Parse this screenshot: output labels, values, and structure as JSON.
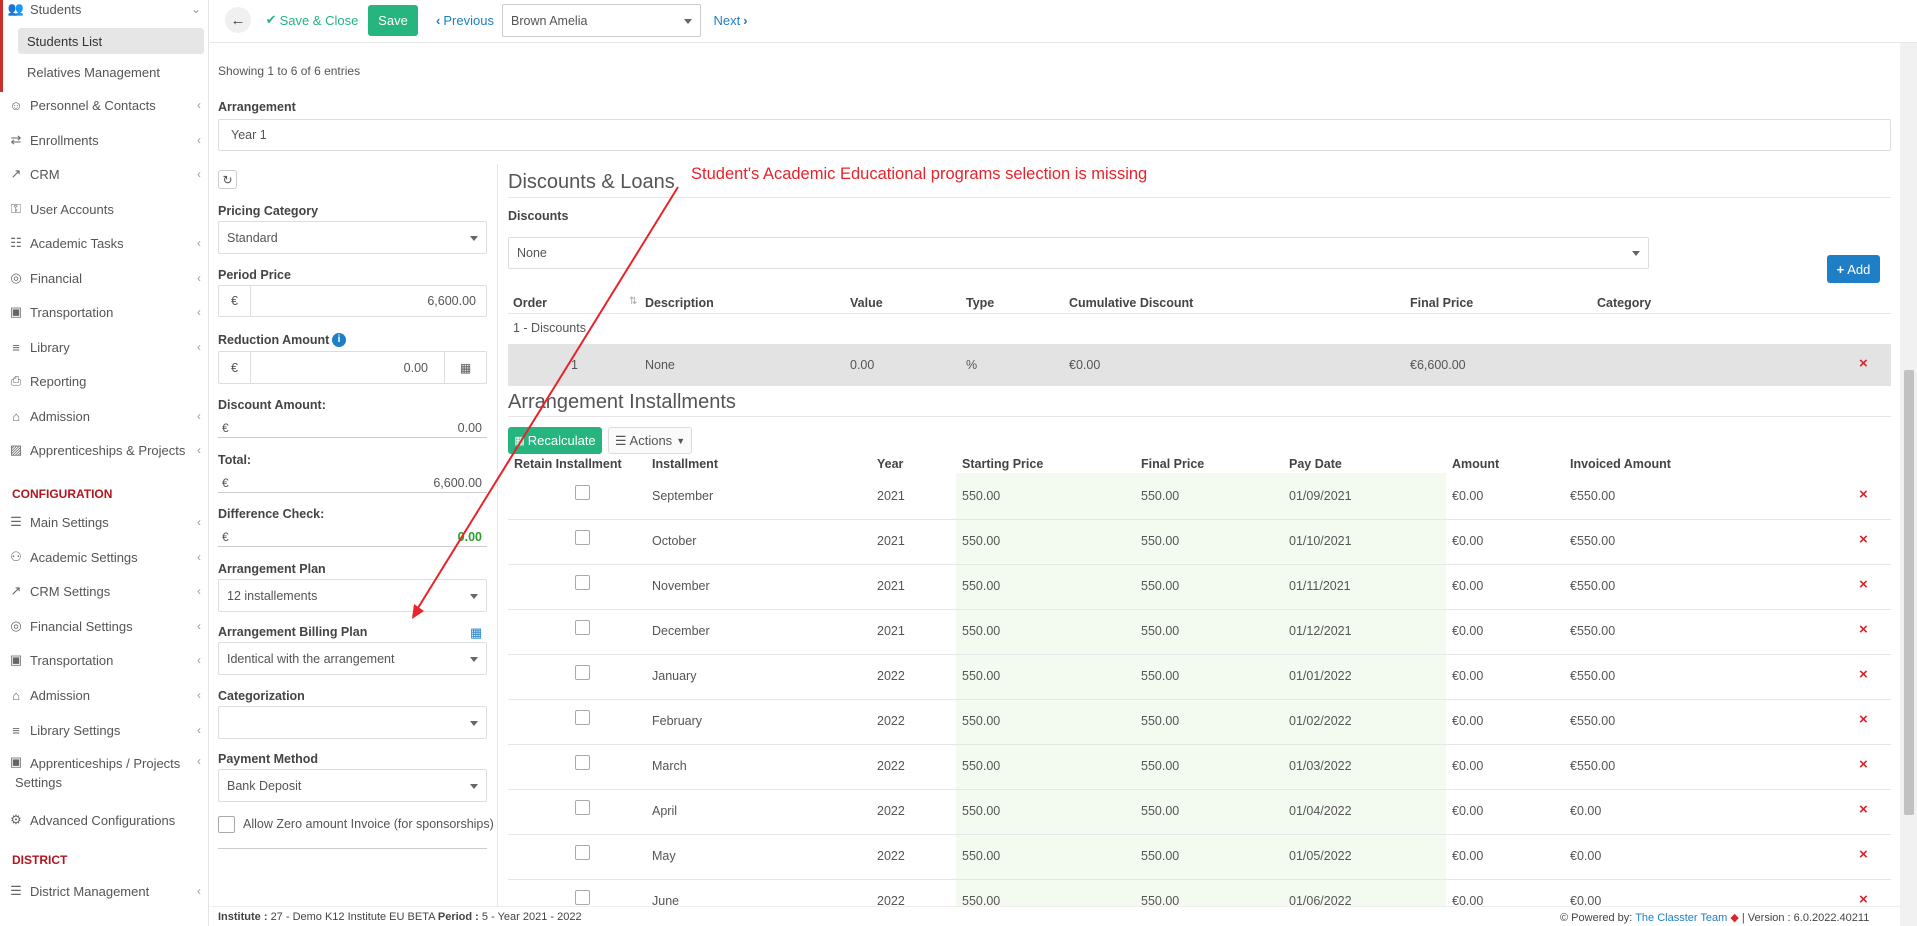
{
  "sidebar": {
    "students_label": "Students",
    "students_list": "Students List",
    "relatives": "Relatives Management",
    "items": [
      {
        "label": "Personnel & Contacts",
        "icon": "person-icon"
      },
      {
        "label": "Enrollments",
        "icon": "exchange-icon"
      },
      {
        "label": "CRM",
        "icon": "crm-icon"
      },
      {
        "label": "User Accounts",
        "icon": "key-icon"
      },
      {
        "label": "Academic Tasks",
        "icon": "tasks-icon"
      },
      {
        "label": "Financial",
        "icon": "coins-icon"
      },
      {
        "label": "Transportation",
        "icon": "bus-icon"
      },
      {
        "label": "Library",
        "icon": "books-icon"
      },
      {
        "label": "Reporting",
        "icon": "printer-icon"
      },
      {
        "label": "Admission",
        "icon": "institution-icon"
      },
      {
        "label": "Apprenticeships & Projects",
        "icon": "cube-icon"
      }
    ],
    "configuration_header": "CONFIGURATION",
    "config_items": [
      {
        "label": "Main Settings",
        "icon": "sliders-icon"
      },
      {
        "label": "Academic Settings",
        "icon": "users-icon"
      },
      {
        "label": "CRM Settings",
        "icon": "crm-icon"
      },
      {
        "label": "Financial Settings",
        "icon": "coins-icon"
      },
      {
        "label": "Transportation",
        "icon": "bus-icon"
      },
      {
        "label": "Admission",
        "icon": "institution-icon"
      },
      {
        "label": "Library Settings",
        "icon": "books-icon"
      }
    ],
    "apprenticeship_settings_1": "Apprenticeships / Projects",
    "apprenticeship_settings_2": "Settings",
    "advanced": "Advanced Configurations",
    "district_header": "DISTRICT",
    "district_mgmt": "District Management"
  },
  "topbar": {
    "save_close": "Save & Close",
    "save": "Save",
    "previous": "Previous",
    "student_select": "Brown Amelia",
    "next": "Next"
  },
  "main": {
    "showing": "Showing 1 to 6 of 6 entries",
    "arrangement_label": "Arrangement",
    "arrangement_value": "Year 1",
    "pricing_category_label": "Pricing Category",
    "pricing_category_value": "Standard",
    "period_price_label": "Period Price",
    "period_price_value": "6,600.00",
    "reduction_label": "Reduction Amount",
    "reduction_value": "0.00",
    "discount_amount_label": "Discount Amount:",
    "discount_amount_value": "0.00",
    "total_label": "Total:",
    "total_value": "6,600.00",
    "difference_label": "Difference Check:",
    "difference_value": "0.00",
    "currency": "€",
    "plan_label": "Arrangement Plan",
    "plan_value": "12 installements",
    "billing_label": "Arrangement Billing Plan",
    "billing_value": "Identical with the arrangement",
    "categorization_label": "Categorization",
    "categorization_value": "",
    "payment_label": "Payment Method",
    "payment_value": "Bank Deposit",
    "zero_invoice_label": "Allow Zero amount Invoice (for sponsorships)"
  },
  "annotation": "Student's Academic Educational programs selection is missing",
  "discounts": {
    "title": "Discounts & Loans",
    "label": "Discounts",
    "select_value": "None",
    "add_button": "Add",
    "headers": [
      "Order",
      "Description",
      "Value",
      "Type",
      "Cumulative Discount",
      "Final Price",
      "Category"
    ],
    "group": "1 - Discounts",
    "row": {
      "order": "1",
      "description": "None",
      "value": "0.00",
      "type": "%",
      "cumulative": "€0.00",
      "final": "€6,600.00",
      "category": ""
    }
  },
  "installments": {
    "title": "Arrangement Installments",
    "recalculate": "Recalculate",
    "actions": "Actions",
    "headers": [
      "Retain Installment",
      "Installment",
      "Year",
      "Starting Price",
      "Final Price",
      "Pay Date",
      "Amount",
      "Invoiced Amount"
    ],
    "rows": [
      {
        "month": "September",
        "year": "2021",
        "start": "550.00",
        "final": "550.00",
        "date": "01/09/2021",
        "amount": "€0.00",
        "invoiced": "€550.00"
      },
      {
        "month": "October",
        "year": "2021",
        "start": "550.00",
        "final": "550.00",
        "date": "01/10/2021",
        "amount": "€0.00",
        "invoiced": "€550.00"
      },
      {
        "month": "November",
        "year": "2021",
        "start": "550.00",
        "final": "550.00",
        "date": "01/11/2021",
        "amount": "€0.00",
        "invoiced": "€550.00"
      },
      {
        "month": "December",
        "year": "2021",
        "start": "550.00",
        "final": "550.00",
        "date": "01/12/2021",
        "amount": "€0.00",
        "invoiced": "€550.00"
      },
      {
        "month": "January",
        "year": "2022",
        "start": "550.00",
        "final": "550.00",
        "date": "01/01/2022",
        "amount": "€0.00",
        "invoiced": "€550.00"
      },
      {
        "month": "February",
        "year": "2022",
        "start": "550.00",
        "final": "550.00",
        "date": "01/02/2022",
        "amount": "€0.00",
        "invoiced": "€550.00"
      },
      {
        "month": "March",
        "year": "2022",
        "start": "550.00",
        "final": "550.00",
        "date": "01/03/2022",
        "amount": "€0.00",
        "invoiced": "€550.00"
      },
      {
        "month": "April",
        "year": "2022",
        "start": "550.00",
        "final": "550.00",
        "date": "01/04/2022",
        "amount": "€0.00",
        "invoiced": "€0.00"
      },
      {
        "month": "May",
        "year": "2022",
        "start": "550.00",
        "final": "550.00",
        "date": "01/05/2022",
        "amount": "€0.00",
        "invoiced": "€0.00"
      },
      {
        "month": "June",
        "year": "2022",
        "start": "550.00",
        "final": "550.00",
        "date": "01/06/2022",
        "amount": "€0.00",
        "invoiced": "€0.00"
      }
    ]
  },
  "footer": {
    "institute_label": "Institute :",
    "institute_value": "27 - Demo K12 Institute EU BETA",
    "period_label": "Period :",
    "period_value": "5 - Year 2021 - 2022",
    "powered_by": "Powered by:",
    "team": "The Classter Team",
    "version": "| Version : 6.0.2022.40211"
  },
  "colors": {
    "accent_green": "#26b47f",
    "brand_blue": "#1f7fc6",
    "danger_red": "#d9232e",
    "header_red": "#b2161e"
  }
}
